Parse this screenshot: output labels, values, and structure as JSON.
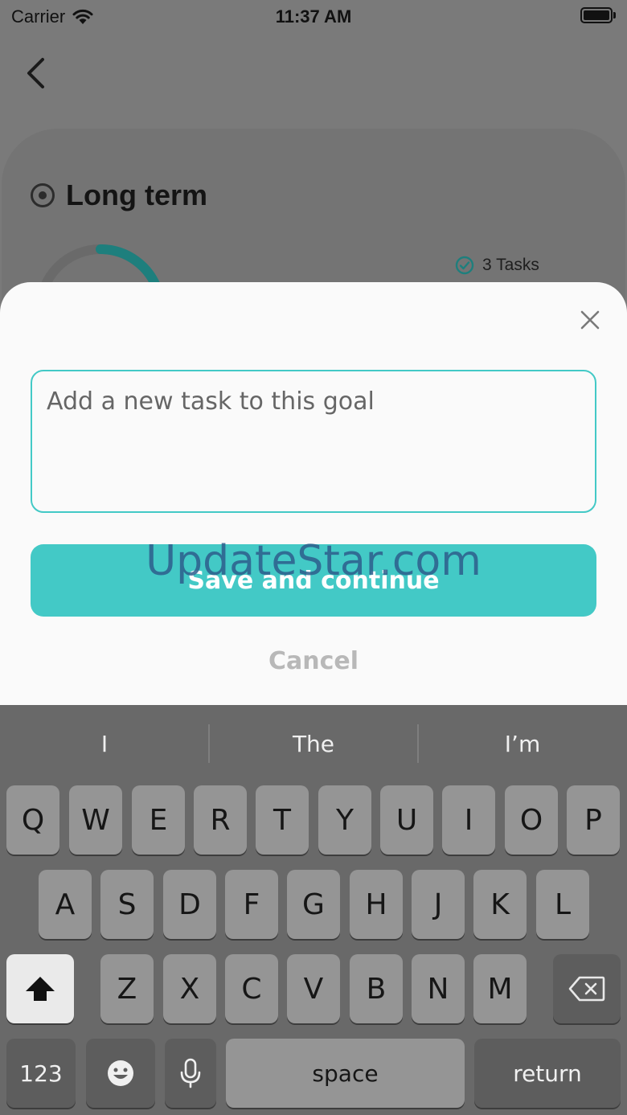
{
  "status_bar": {
    "carrier": "Carrier",
    "time": "11:37 AM"
  },
  "goal": {
    "title": "Long term",
    "tasks_count": "3 Tasks",
    "progress_fraction": 0.2
  },
  "sheet": {
    "input_placeholder": "Add a new task to this goal",
    "save_label": "Save and continue",
    "cancel_label": "Cancel",
    "watermark": "UpdateStar.com"
  },
  "keyboard": {
    "suggestions": [
      "I",
      "The",
      "I’m"
    ],
    "row1": [
      "Q",
      "W",
      "E",
      "R",
      "T",
      "Y",
      "U",
      "I",
      "O",
      "P"
    ],
    "row2": [
      "A",
      "S",
      "D",
      "F",
      "G",
      "H",
      "J",
      "K",
      "L"
    ],
    "row3": [
      "Z",
      "X",
      "C",
      "V",
      "B",
      "N",
      "M"
    ],
    "numbers_label": "123",
    "space_label": "space",
    "return_label": "return"
  },
  "colors": {
    "accent": "#43c9c6",
    "progress": "#1e7f7d",
    "watermark": "#2d5d8c"
  }
}
